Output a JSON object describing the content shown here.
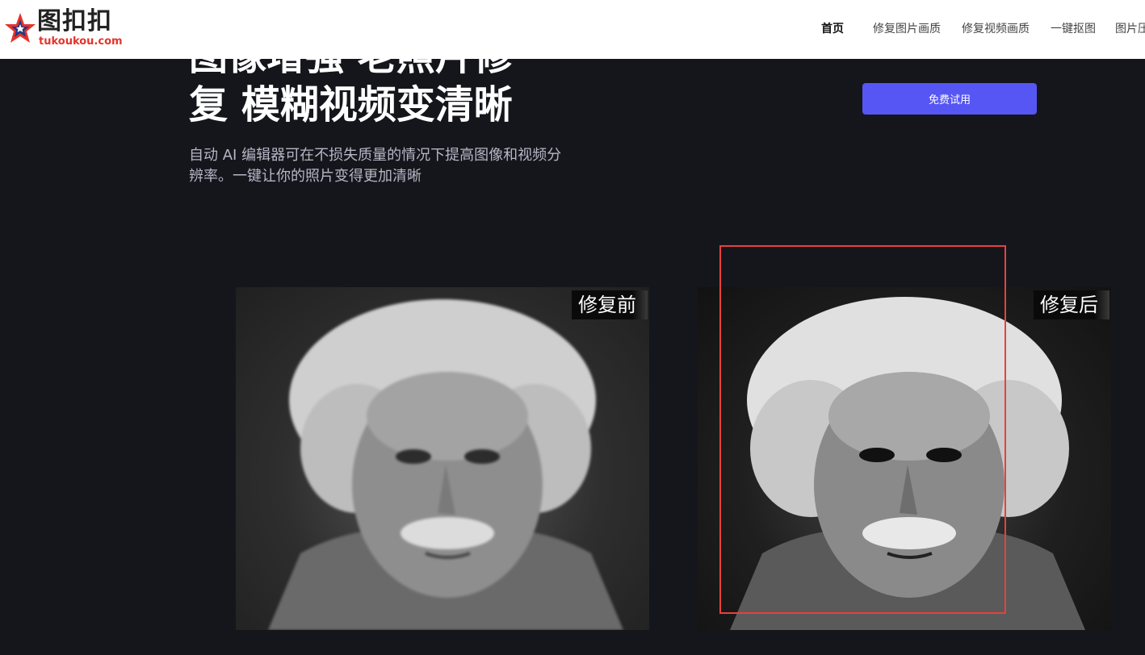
{
  "brand": {
    "name": "图扣扣",
    "domain": "tukoukou.com",
    "colors": {
      "star_red": "#e5332a",
      "star_blue": "#1f3a8a"
    }
  },
  "nav": {
    "items": [
      {
        "label": "首页",
        "active": true
      },
      {
        "label": "修复图片画质",
        "active": false
      },
      {
        "label": "修复视频画质",
        "active": false
      },
      {
        "label": "一键抠图",
        "active": false
      },
      {
        "label": "图片压缩",
        "active": false
      }
    ]
  },
  "hero": {
    "title_line1": "图像增强 老照片修",
    "title_line2": "复 模糊视频变清晰",
    "subtitle": "自动 AI 编辑器可在不损失质量的情况下提高图像和视频分辨率。一键让你的照片变得更加清晰",
    "cta_label": "免费试用",
    "accent_color": "#5656f5"
  },
  "comparison": {
    "before_label": "修复前",
    "after_label": "修复后",
    "highlight_color": "#e8413b"
  }
}
